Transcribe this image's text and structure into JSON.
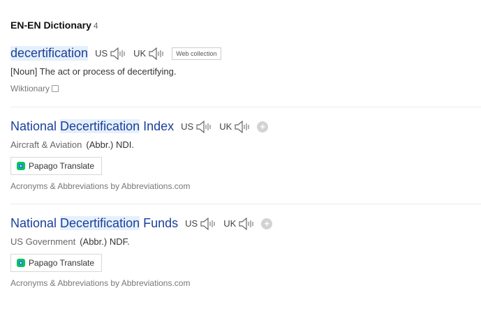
{
  "section": {
    "title": "EN-EN Dictionary",
    "count": "4"
  },
  "entry1": {
    "word": "decertification",
    "us_label": "US",
    "uk_label": "UK",
    "tag": "Web collection",
    "definition": "[Noun] The act or process of decertifying.",
    "source": "Wiktionary"
  },
  "entry2": {
    "pre": "National ",
    "highlight": "Decertification",
    "post": " Index",
    "us_label": "US",
    "uk_label": "UK",
    "category": "Aircraft & Aviation",
    "abbr": "(Abbr.) NDI.",
    "translate_label": "Papago Translate",
    "source": "Acronyms & Abbreviations by Abbreviations.com"
  },
  "entry3": {
    "pre": "National ",
    "highlight": "Decertification",
    "post": " Funds",
    "us_label": "US",
    "uk_label": "UK",
    "category": "US Government",
    "abbr": "(Abbr.) NDF.",
    "translate_label": "Papago Translate",
    "source": "Acronyms & Abbreviations by Abbreviations.com"
  },
  "icons": {
    "speaker": "speaker-icon",
    "add": "plus-icon",
    "papago": "papago-logo-icon",
    "window": "open-window-icon"
  },
  "colors": {
    "headword": "#1a3f9b",
    "highlight": "#e6f0fb",
    "papago_green": "#03c75a",
    "papago_blue": "#2c7be5"
  }
}
